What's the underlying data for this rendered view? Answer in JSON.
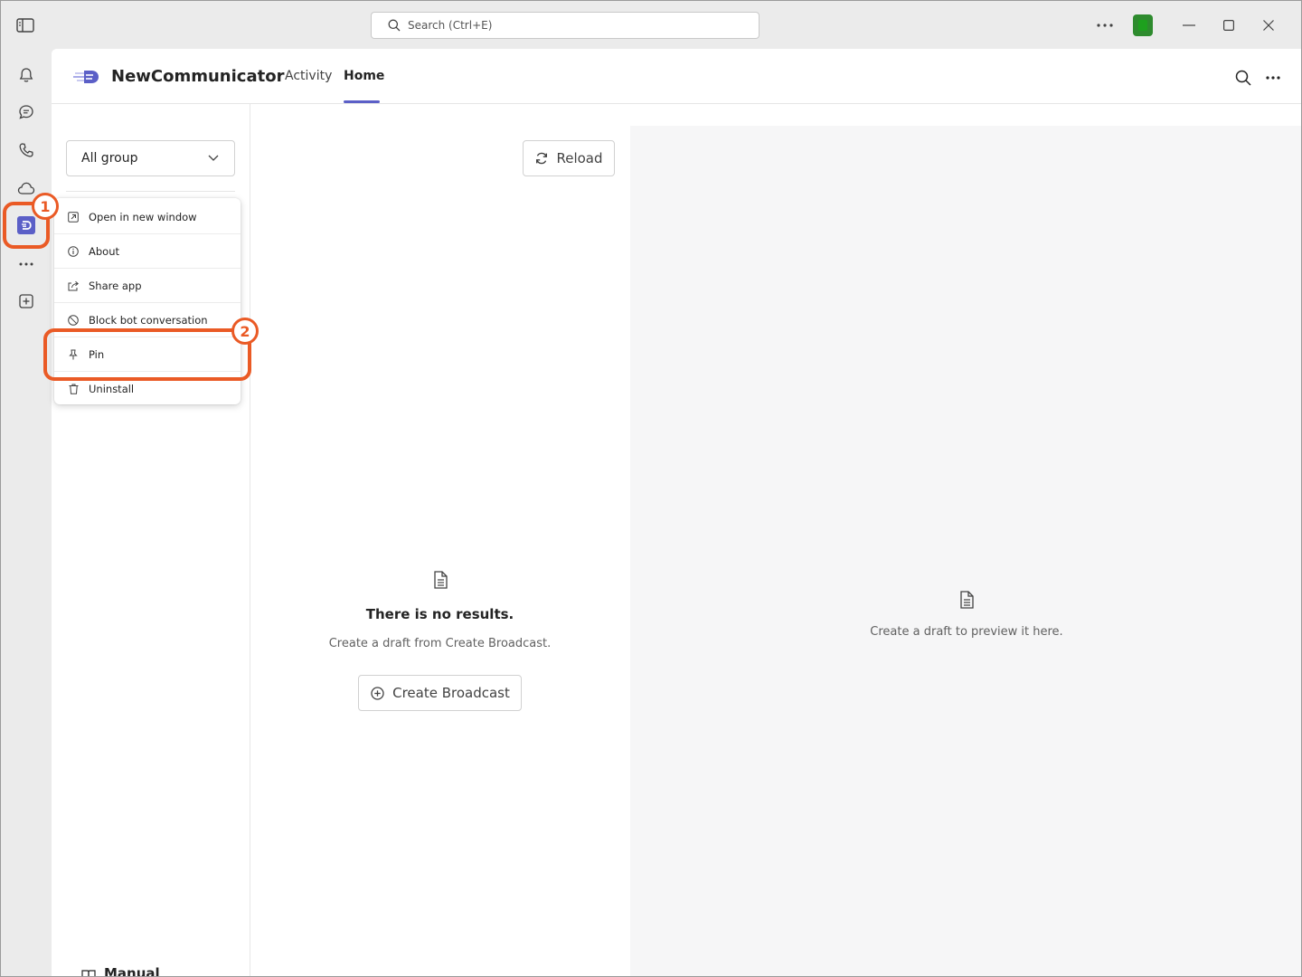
{
  "titlebar": {
    "search_placeholder": "Search (Ctrl+E)"
  },
  "rail": {
    "items": [
      "bell-icon",
      "chat-icon",
      "call-icon",
      "cloud-icon",
      "newcommunicator-app-icon",
      "more-apps-icon",
      "add-app-icon"
    ]
  },
  "app": {
    "name": "NewCommunicator",
    "tabs": [
      {
        "label": "Activity",
        "active": false
      },
      {
        "label": "Home",
        "active": true
      }
    ]
  },
  "filter": {
    "selected": "All group"
  },
  "toolbar": {
    "reload_label": "Reload"
  },
  "empty_state": {
    "title": "There is no results.",
    "subtitle": "Create a draft from Create Broadcast.",
    "button_label": "Create Broadcast"
  },
  "preview": {
    "message": "Create a draft to preview it here."
  },
  "context_menu": {
    "items": [
      {
        "label": "Open in new window",
        "icon": "open-external-icon"
      },
      {
        "label": "About",
        "icon": "info-icon"
      },
      {
        "label": "Share app",
        "icon": "share-icon"
      },
      {
        "label": "Block bot conversation",
        "icon": "block-icon"
      },
      {
        "label": "Pin",
        "icon": "pin-icon"
      },
      {
        "label": "Uninstall",
        "icon": "trash-icon"
      }
    ]
  },
  "callouts": {
    "one": "1",
    "two": "2"
  },
  "footer": {
    "manual_label": "Manual"
  },
  "colors": {
    "accent": "#5b5fc7",
    "callout": "#ea5a25"
  }
}
